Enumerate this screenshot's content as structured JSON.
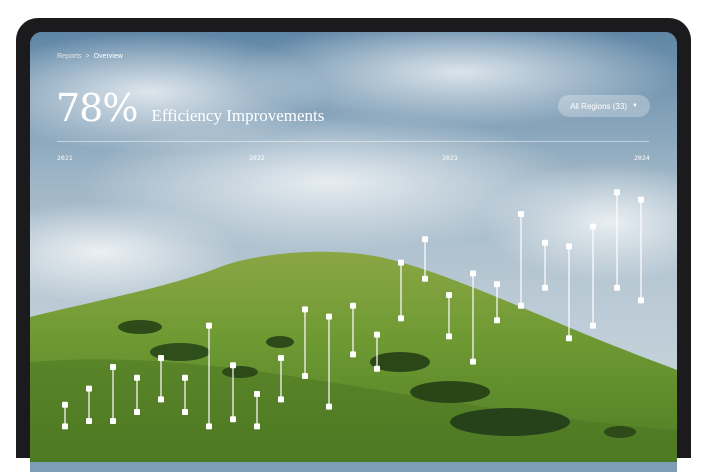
{
  "breadcrumb": {
    "parent": "Reports",
    "separator": ">",
    "current": "Overview"
  },
  "kpi": {
    "value": "78%",
    "label": "Efficiency Improvements"
  },
  "region_filter": {
    "label": "All Regions (33)",
    "icon": "caret-down-icon"
  },
  "timeline": {
    "years": [
      "2021",
      "2022",
      "2023",
      "2024"
    ]
  },
  "colors": {
    "marker": "#ffffff",
    "line": "#ffffff"
  },
  "chart_data": {
    "type": "range",
    "description_units": "efficiency index (relative, estimated from marker heights)",
    "x": [
      0,
      1,
      2,
      3,
      4,
      5,
      6,
      7,
      8,
      9,
      10,
      11,
      12,
      13,
      14,
      15,
      16,
      17,
      18,
      19,
      20,
      21,
      22,
      23,
      24
    ],
    "ranges": [
      {
        "low": 2,
        "high": 14
      },
      {
        "low": 5,
        "high": 23
      },
      {
        "low": 5,
        "high": 35
      },
      {
        "low": 10,
        "high": 29
      },
      {
        "low": 17,
        "high": 40
      },
      {
        "low": 10,
        "high": 29
      },
      {
        "low": 2,
        "high": 58
      },
      {
        "low": 6,
        "high": 36
      },
      {
        "low": 2,
        "high": 20
      },
      {
        "low": 17,
        "high": 40
      },
      {
        "low": 30,
        "high": 67
      },
      {
        "low": 13,
        "high": 63
      },
      {
        "low": 42,
        "high": 69
      },
      {
        "low": 34,
        "high": 53
      },
      {
        "low": 62,
        "high": 93
      },
      {
        "low": 84,
        "high": 106
      },
      {
        "low": 52,
        "high": 75
      },
      {
        "low": 38,
        "high": 87
      },
      {
        "low": 61,
        "high": 81
      },
      {
        "low": 69,
        "high": 120
      },
      {
        "low": 79,
        "high": 104
      },
      {
        "low": 51,
        "high": 102
      },
      {
        "low": 58,
        "high": 113
      },
      {
        "low": 79,
        "high": 132
      },
      {
        "low": 72,
        "high": 128
      }
    ],
    "ylim": [
      0,
      140
    ]
  }
}
